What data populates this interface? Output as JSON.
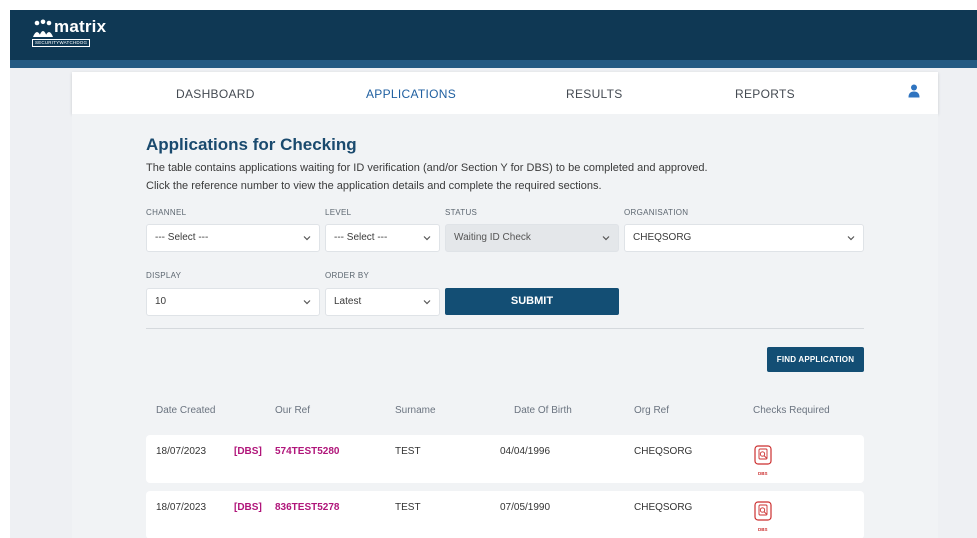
{
  "brand": {
    "name": "matrix",
    "tagline": "SECURITYWATCHDOG"
  },
  "nav": {
    "items": [
      "DASHBOARD",
      "APPLICATIONS",
      "RESULTS",
      "REPORTS"
    ],
    "active": "APPLICATIONS",
    "user_icon": "user-icon"
  },
  "page": {
    "title": "Applications for Checking",
    "description_line1": "The table contains applications waiting for ID verification (and/or Section Y for DBS) to be completed and approved.",
    "description_line2": "Click the reference number to view the application details and complete the required sections."
  },
  "filters": {
    "channel": {
      "label": "CHANNEL",
      "value": "--- Select ---"
    },
    "level": {
      "label": "LEVEL",
      "value": "--- Select ---"
    },
    "status": {
      "label": "STATUS",
      "value": "Waiting ID Check"
    },
    "organisation": {
      "label": "ORGANISATION",
      "value": "CHEQSORG"
    },
    "display": {
      "label": "DISPLAY",
      "value": "10"
    },
    "order_by": {
      "label": "ORDER BY",
      "value": "Latest"
    },
    "submit_label": "SUBMIT"
  },
  "find_application_label": "FIND APPLICATION",
  "table": {
    "headers": [
      "Date Created",
      "Our Ref",
      "Surname",
      "Date Of Birth",
      "Org Ref",
      "Checks Required"
    ],
    "rows": [
      {
        "date_created": "18/07/2023",
        "type": "[DBS]",
        "our_ref": "574TEST5280",
        "surname": "TEST",
        "dob": "04/04/1996",
        "org_ref": "CHEQSORG",
        "check": "DBS"
      },
      {
        "date_created": "18/07/2023",
        "type": "[DBS]",
        "our_ref": "836TEST5278",
        "surname": "TEST",
        "dob": "07/05/1990",
        "org_ref": "CHEQSORG",
        "check": "DBS"
      }
    ]
  },
  "colors": {
    "header_bg": "#0f3854",
    "accent": "#1f5fa0",
    "button_bg": "#134e74",
    "ref_color": "#b0157a",
    "check_icon": "#cc2f2f"
  }
}
